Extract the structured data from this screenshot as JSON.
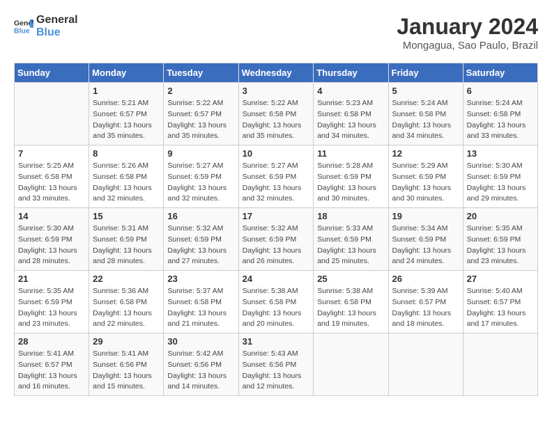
{
  "header": {
    "logo_line1": "General",
    "logo_line2": "Blue",
    "month": "January 2024",
    "location": "Mongagua, Sao Paulo, Brazil"
  },
  "weekdays": [
    "Sunday",
    "Monday",
    "Tuesday",
    "Wednesday",
    "Thursday",
    "Friday",
    "Saturday"
  ],
  "weeks": [
    [
      {
        "day": "",
        "info": ""
      },
      {
        "day": "1",
        "info": "Sunrise: 5:21 AM\nSunset: 6:57 PM\nDaylight: 13 hours\nand 35 minutes."
      },
      {
        "day": "2",
        "info": "Sunrise: 5:22 AM\nSunset: 6:57 PM\nDaylight: 13 hours\nand 35 minutes."
      },
      {
        "day": "3",
        "info": "Sunrise: 5:22 AM\nSunset: 6:58 PM\nDaylight: 13 hours\nand 35 minutes."
      },
      {
        "day": "4",
        "info": "Sunrise: 5:23 AM\nSunset: 6:58 PM\nDaylight: 13 hours\nand 34 minutes."
      },
      {
        "day": "5",
        "info": "Sunrise: 5:24 AM\nSunset: 6:58 PM\nDaylight: 13 hours\nand 34 minutes."
      },
      {
        "day": "6",
        "info": "Sunrise: 5:24 AM\nSunset: 6:58 PM\nDaylight: 13 hours\nand 33 minutes."
      }
    ],
    [
      {
        "day": "7",
        "info": "Sunrise: 5:25 AM\nSunset: 6:58 PM\nDaylight: 13 hours\nand 33 minutes."
      },
      {
        "day": "8",
        "info": "Sunrise: 5:26 AM\nSunset: 6:58 PM\nDaylight: 13 hours\nand 32 minutes."
      },
      {
        "day": "9",
        "info": "Sunrise: 5:27 AM\nSunset: 6:59 PM\nDaylight: 13 hours\nand 32 minutes."
      },
      {
        "day": "10",
        "info": "Sunrise: 5:27 AM\nSunset: 6:59 PM\nDaylight: 13 hours\nand 32 minutes."
      },
      {
        "day": "11",
        "info": "Sunrise: 5:28 AM\nSunset: 6:59 PM\nDaylight: 13 hours\nand 30 minutes."
      },
      {
        "day": "12",
        "info": "Sunrise: 5:29 AM\nSunset: 6:59 PM\nDaylight: 13 hours\nand 30 minutes."
      },
      {
        "day": "13",
        "info": "Sunrise: 5:30 AM\nSunset: 6:59 PM\nDaylight: 13 hours\nand 29 minutes."
      }
    ],
    [
      {
        "day": "14",
        "info": "Sunrise: 5:30 AM\nSunset: 6:59 PM\nDaylight: 13 hours\nand 28 minutes."
      },
      {
        "day": "15",
        "info": "Sunrise: 5:31 AM\nSunset: 6:59 PM\nDaylight: 13 hours\nand 28 minutes."
      },
      {
        "day": "16",
        "info": "Sunrise: 5:32 AM\nSunset: 6:59 PM\nDaylight: 13 hours\nand 27 minutes."
      },
      {
        "day": "17",
        "info": "Sunrise: 5:32 AM\nSunset: 6:59 PM\nDaylight: 13 hours\nand 26 minutes."
      },
      {
        "day": "18",
        "info": "Sunrise: 5:33 AM\nSunset: 6:59 PM\nDaylight: 13 hours\nand 25 minutes."
      },
      {
        "day": "19",
        "info": "Sunrise: 5:34 AM\nSunset: 6:59 PM\nDaylight: 13 hours\nand 24 minutes."
      },
      {
        "day": "20",
        "info": "Sunrise: 5:35 AM\nSunset: 6:59 PM\nDaylight: 13 hours\nand 23 minutes."
      }
    ],
    [
      {
        "day": "21",
        "info": "Sunrise: 5:35 AM\nSunset: 6:59 PM\nDaylight: 13 hours\nand 23 minutes."
      },
      {
        "day": "22",
        "info": "Sunrise: 5:36 AM\nSunset: 6:58 PM\nDaylight: 13 hours\nand 22 minutes."
      },
      {
        "day": "23",
        "info": "Sunrise: 5:37 AM\nSunset: 6:58 PM\nDaylight: 13 hours\nand 21 minutes."
      },
      {
        "day": "24",
        "info": "Sunrise: 5:38 AM\nSunset: 6:58 PM\nDaylight: 13 hours\nand 20 minutes."
      },
      {
        "day": "25",
        "info": "Sunrise: 5:38 AM\nSunset: 6:58 PM\nDaylight: 13 hours\nand 19 minutes."
      },
      {
        "day": "26",
        "info": "Sunrise: 5:39 AM\nSunset: 6:57 PM\nDaylight: 13 hours\nand 18 minutes."
      },
      {
        "day": "27",
        "info": "Sunrise: 5:40 AM\nSunset: 6:57 PM\nDaylight: 13 hours\nand 17 minutes."
      }
    ],
    [
      {
        "day": "28",
        "info": "Sunrise: 5:41 AM\nSunset: 6:57 PM\nDaylight: 13 hours\nand 16 minutes."
      },
      {
        "day": "29",
        "info": "Sunrise: 5:41 AM\nSunset: 6:56 PM\nDaylight: 13 hours\nand 15 minutes."
      },
      {
        "day": "30",
        "info": "Sunrise: 5:42 AM\nSunset: 6:56 PM\nDaylight: 13 hours\nand 14 minutes."
      },
      {
        "day": "31",
        "info": "Sunrise: 5:43 AM\nSunset: 6:56 PM\nDaylight: 13 hours\nand 12 minutes."
      },
      {
        "day": "",
        "info": ""
      },
      {
        "day": "",
        "info": ""
      },
      {
        "day": "",
        "info": ""
      }
    ]
  ]
}
